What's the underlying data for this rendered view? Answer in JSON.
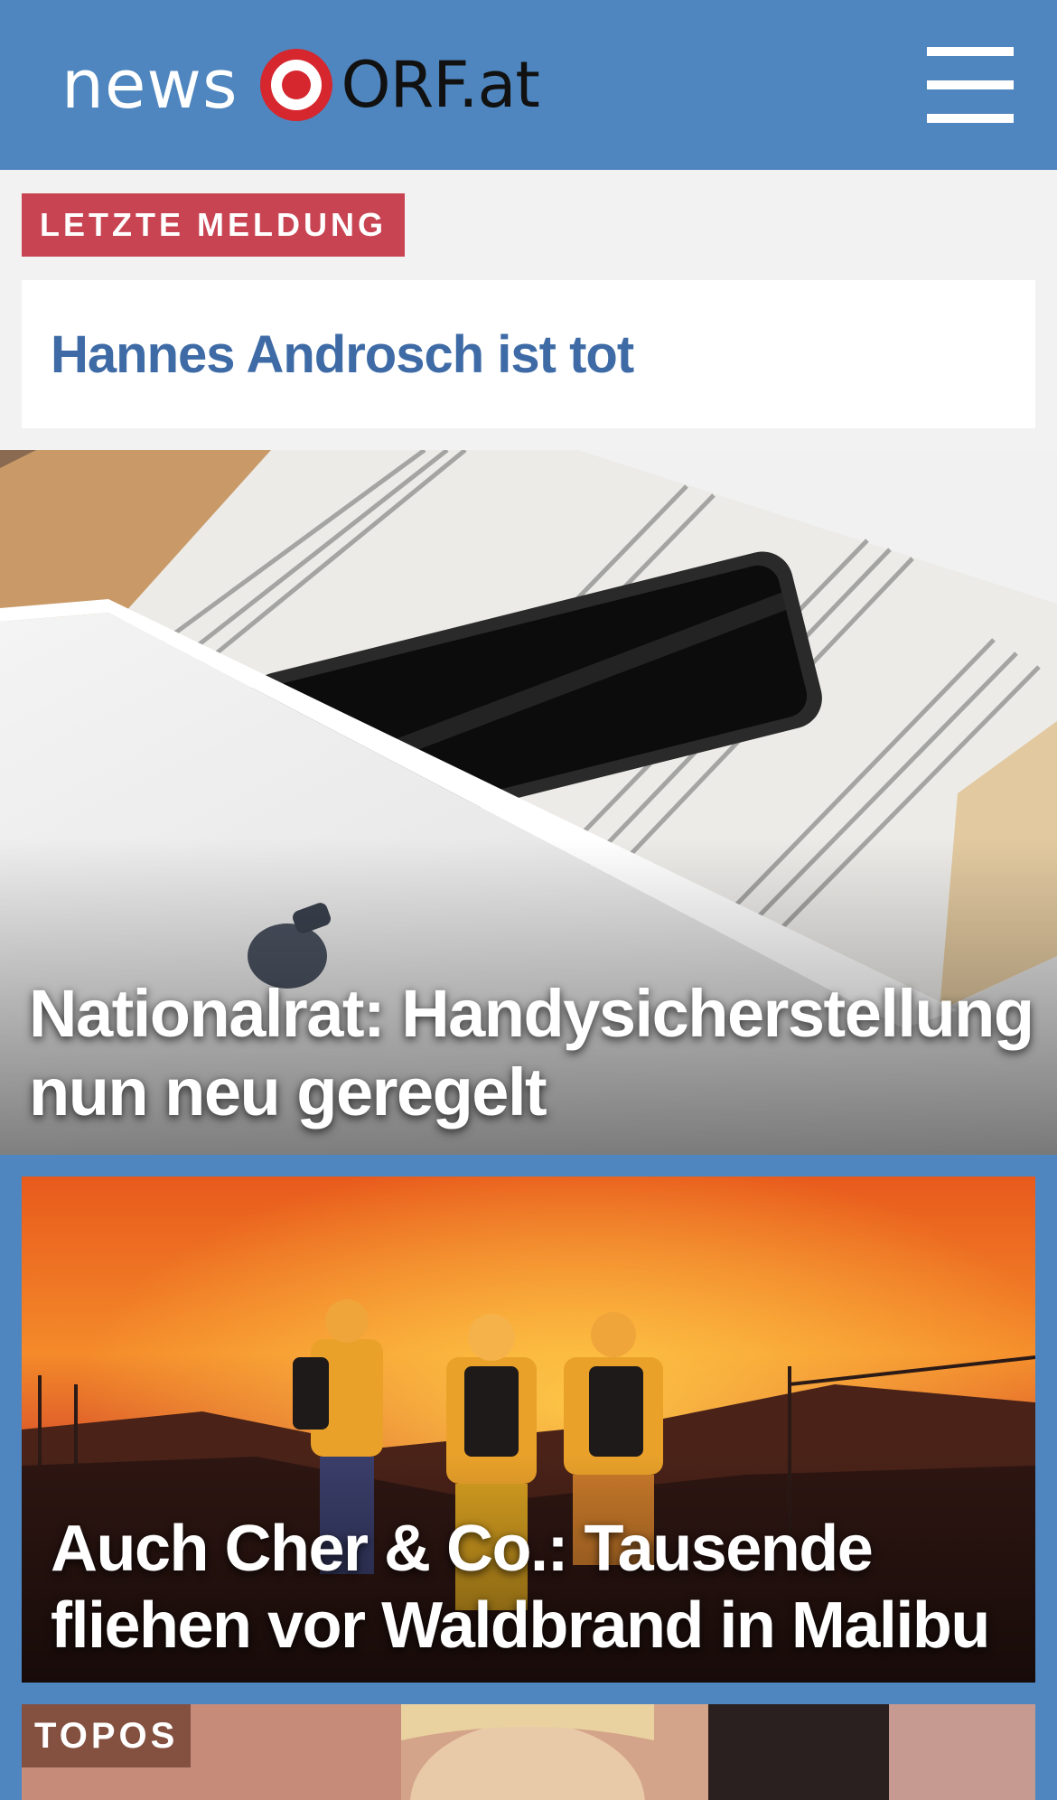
{
  "header": {
    "logo_news": "news",
    "logo_orf": "ORF.at",
    "background_color": "#4f86bf",
    "menu_icon": "hamburger-menu-icon"
  },
  "breaking": {
    "tag": "LETZTE MELDUNG",
    "tag_color": "#c84452",
    "headline": "Hannes Androsch ist tot"
  },
  "stories": [
    {
      "title": "Nationalrat: Handysicherstellung nun neu geregelt",
      "image": "smartphone-in-drawer-photo"
    },
    {
      "title": "Auch Cher & Co.: Tausende fliehen vor Waldbrand in Malibu",
      "image": "firefighters-wildfire-photo"
    },
    {
      "tag": "TOPOS",
      "image": "woman-portrait-photo"
    }
  ]
}
